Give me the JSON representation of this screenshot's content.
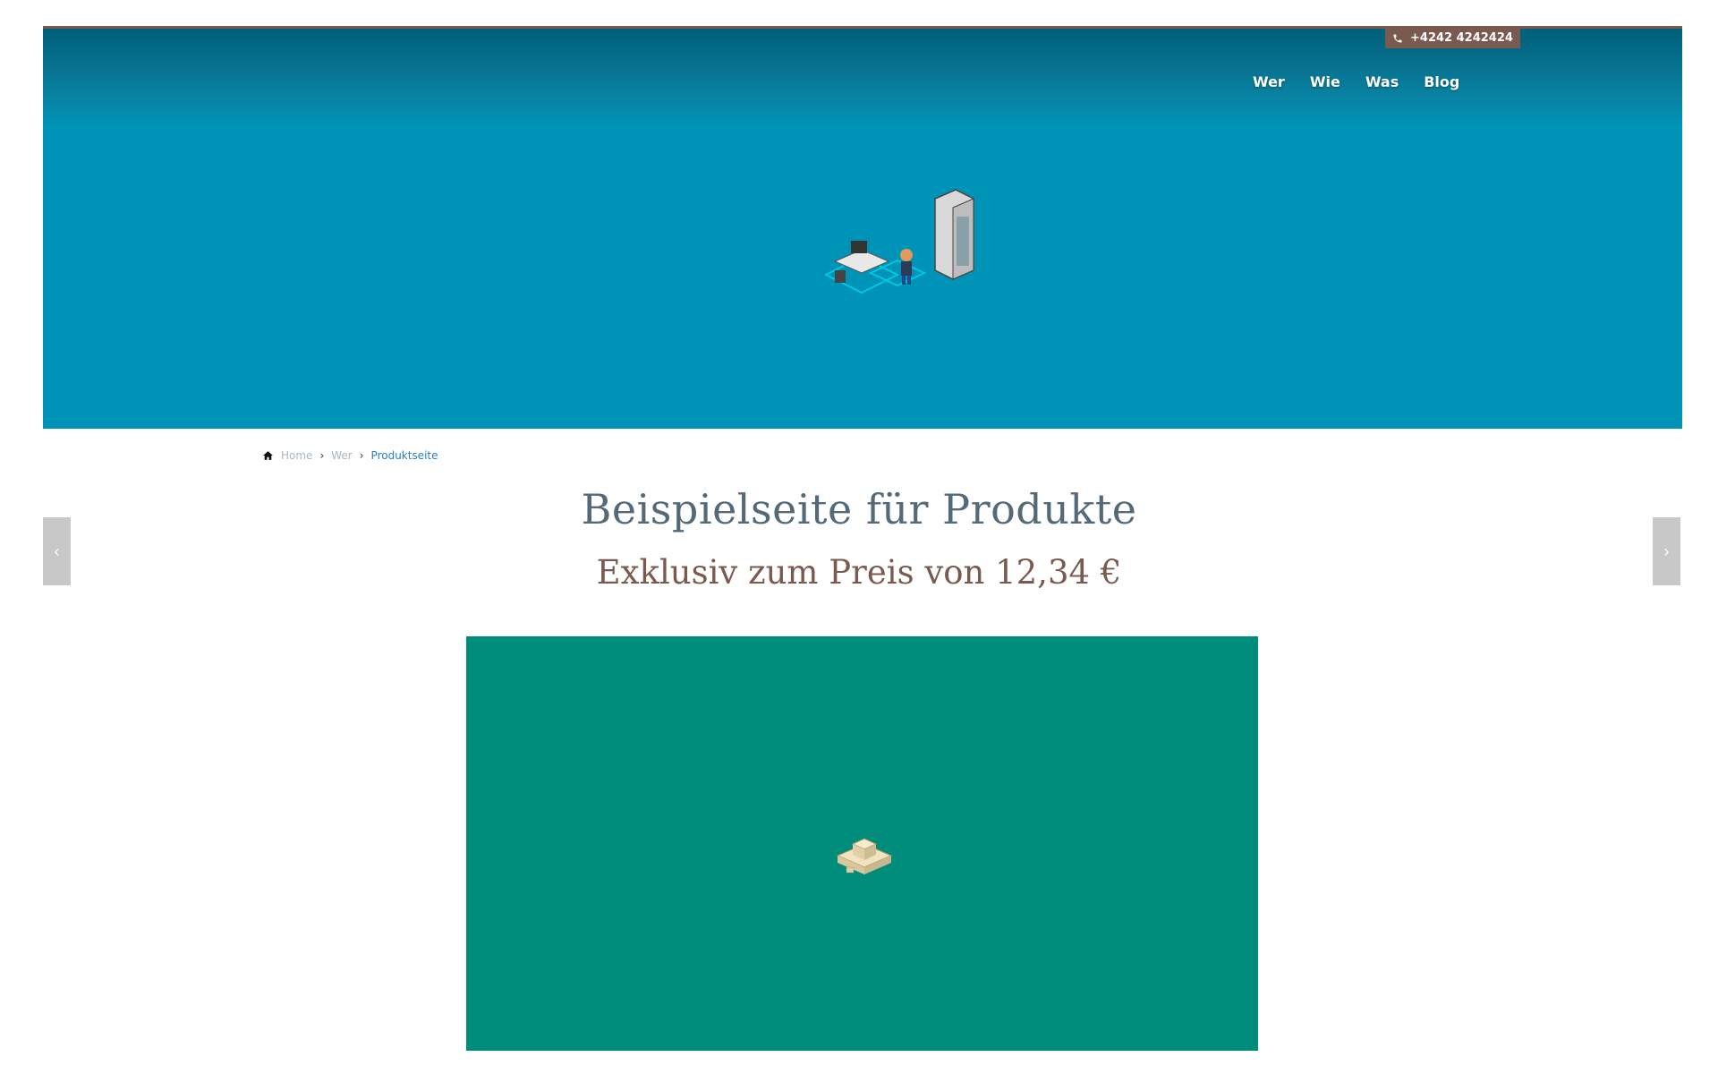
{
  "header": {
    "phone": "+4242 4242424",
    "nav": [
      "Wer",
      "Wie",
      "Was",
      "Blog"
    ]
  },
  "breadcrumb": {
    "items": [
      "Home",
      "Wer",
      "Produktseite"
    ]
  },
  "main": {
    "title": "Beispielseite für Produkte",
    "price": "Exklusiv zum Preis von 12,34 €"
  },
  "slider": {
    "prev_label": "‹",
    "next_label": "›"
  },
  "colors": {
    "hero": "#0093b8",
    "accent": "#7a5a4e",
    "title": "#546a78",
    "product_box": "#008c7a"
  },
  "icons": {
    "phone": "phone-icon",
    "home": "home-icon",
    "separator": "chevron-right-icon"
  }
}
